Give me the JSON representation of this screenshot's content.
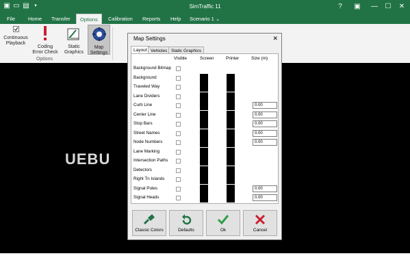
{
  "titlebar": {
    "title": "SimTraffic 11",
    "quick_access_icons": [
      "app-icon",
      "folder-icon",
      "save-icon",
      "dropdown-icon"
    ],
    "window_controls": [
      "help-icon",
      "ribbon-display-icon",
      "minimize-icon",
      "maximize-icon",
      "close-icon"
    ]
  },
  "ribbon": {
    "tabs": [
      {
        "label": "File"
      },
      {
        "label": "Home"
      },
      {
        "label": "Transfer"
      },
      {
        "label": "Options",
        "active": true
      },
      {
        "label": "Calibration"
      },
      {
        "label": "Reports"
      },
      {
        "label": "Help"
      }
    ],
    "scenario": "Scenario 1",
    "buttons": {
      "continuous_line1": "Continuous",
      "continuous_line2": "Playback",
      "coding_line1": "Coding",
      "coding_line2": "Error Check",
      "static_line1": "Static",
      "static_line2": "Graphics",
      "map_line1": "Map",
      "map_line2": "Settings"
    },
    "group_label": "Options"
  },
  "canvas": {
    "logo": "UEBU"
  },
  "dialog": {
    "title": "Map Settings",
    "tabs": [
      "Layout",
      "Vehicles",
      "Static Graphics"
    ],
    "columns": {
      "visible": "Visible",
      "screen": "Screen",
      "printer": "Printer",
      "size": "Size (m)"
    },
    "rows": [
      {
        "label": "Background Bitmap"
      },
      {
        "label": "Background"
      },
      {
        "label": "Traveled Way"
      },
      {
        "label": "Lane Dividers"
      },
      {
        "label": "Curb Line",
        "size": "0.00"
      },
      {
        "label": "Center Line",
        "size": "0.00"
      },
      {
        "label": "Stop Bars",
        "size": "0.00"
      },
      {
        "label": "Street Names",
        "size": "0.00"
      },
      {
        "label": "Node Numbers",
        "size": "0.00"
      },
      {
        "label": "Lane Marking"
      },
      {
        "label": "Intersection Paths"
      },
      {
        "label": "Detectors"
      },
      {
        "label": "Right Tn Islands"
      },
      {
        "label": "Signal Poles",
        "size": "0.00"
      },
      {
        "label": "Signal Heads",
        "size": "0.00"
      }
    ],
    "buttons": {
      "classic": "Classic Colors",
      "defaults": "Defaults",
      "ok": "Ok",
      "cancel": "Cancel"
    },
    "colors": {
      "swatch": "#000000",
      "accent": "#217346",
      "ok_check": "#2e9e49",
      "cancel_x": "#c8202f"
    }
  }
}
